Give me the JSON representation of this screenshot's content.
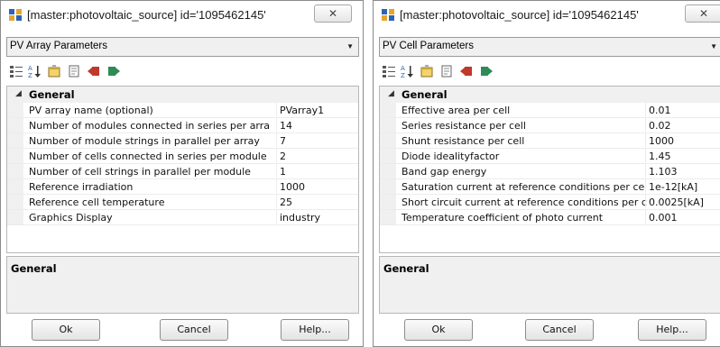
{
  "left": {
    "title": "[master:photovoltaic_source] id='1095462145'",
    "close_glyph": "✕",
    "combo_value": "PV Array Parameters",
    "category": "General",
    "rows": [
      {
        "name": "PV array name (optional)",
        "value": "PVarray1"
      },
      {
        "name": "Number of modules connected in series per arra",
        "value": "14"
      },
      {
        "name": "Number of module strings in parallel per array",
        "value": "7"
      },
      {
        "name": "Number of cells connected in series per module",
        "value": "2"
      },
      {
        "name": "Number of cell strings in parallel per module",
        "value": "1"
      },
      {
        "name": "Reference irradiation",
        "value": "1000"
      },
      {
        "name": "Reference cell temperature",
        "value": "25"
      },
      {
        "name": "Graphics Display",
        "value": "industry"
      }
    ],
    "description_title": "General",
    "buttons": {
      "ok": "Ok",
      "cancel": "Cancel",
      "help": "Help..."
    }
  },
  "right": {
    "title": "[master:photovoltaic_source] id='1095462145'",
    "close_glyph": "✕",
    "combo_value": "PV Cell Parameters",
    "category": "General",
    "rows": [
      {
        "name": "Effective area per cell",
        "value": "0.01"
      },
      {
        "name": "Series resistance per cell",
        "value": "0.02"
      },
      {
        "name": "Shunt resistance per cell",
        "value": "1000"
      },
      {
        "name": "Diode idealityfactor",
        "value": "1.45"
      },
      {
        "name": "Band gap energy",
        "value": "1.103"
      },
      {
        "name": "Saturation current at reference conditions per ce",
        "value": "1e-12[kA]"
      },
      {
        "name": "Short circuit current at reference conditions per c",
        "value": "0.0025[kA]"
      },
      {
        "name": "Temperature coefficient of photo current",
        "value": "0.001"
      }
    ],
    "description_title": "General",
    "buttons": {
      "ok": "Ok",
      "cancel": "Cancel",
      "help": "Help..."
    }
  },
  "toolbar_icons": [
    "categorized-icon",
    "sort-alphabetical-icon",
    "properties-icon",
    "property-pages-icon",
    "import-icon",
    "export-icon"
  ],
  "colors": {
    "accent_red": "#c0392b",
    "accent_green": "#2e8b57",
    "accent_blue": "#2a63b8"
  }
}
